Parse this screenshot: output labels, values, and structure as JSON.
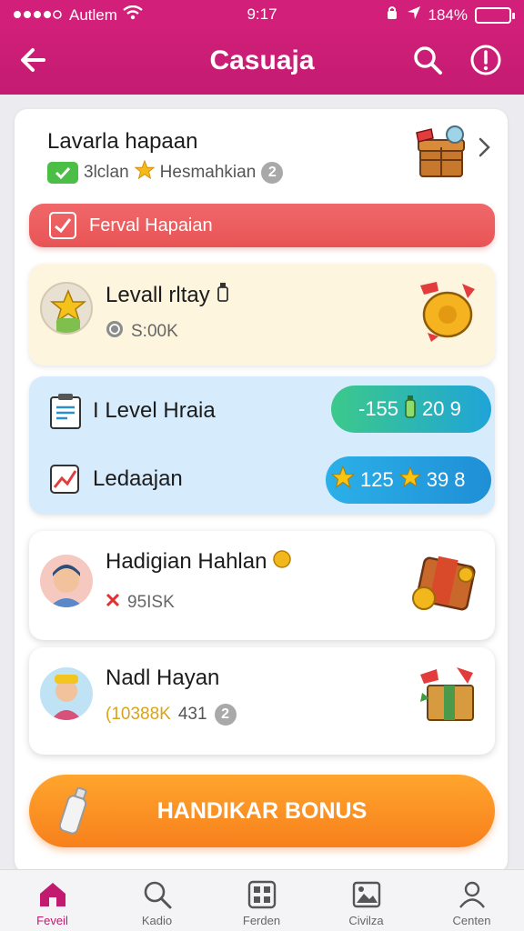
{
  "status_bar": {
    "carrier": "Autlem",
    "time": "9:17",
    "battery": "184%"
  },
  "app_bar": {
    "title": "Casuaja"
  },
  "header": {
    "title": "Lavarla hapaan",
    "sub_label": "3lclan",
    "sub_name": "Hesmahkian",
    "sub_count": "2"
  },
  "alert_bar": {
    "label": "Ferval Hapaian"
  },
  "cards": {
    "level_card": {
      "title": "Levall rltay",
      "value": "S:00K"
    },
    "level_list": [
      {
        "label": "I Level Hraia",
        "pill_left": "-155",
        "pill_right": "20 9"
      },
      {
        "label": "Ledaajan",
        "pill_left": "125",
        "pill_right": "39 8"
      }
    ],
    "player_1": {
      "title": "Hadigian Hahlan",
      "value": "95ISK"
    },
    "player_2": {
      "title": "Nadl Hayan",
      "value": "(10388K",
      "extra": "431",
      "count": "2"
    }
  },
  "bonus_button": {
    "label": "HANDIKAR BONUS"
  },
  "tabs": [
    {
      "label": "Feveil",
      "icon": "home-icon",
      "active": true
    },
    {
      "label": "Kadio",
      "icon": "search-icon",
      "active": false
    },
    {
      "label": "Ferden",
      "icon": "grid-icon",
      "active": false
    },
    {
      "label": "Civilza",
      "icon": "picture-icon",
      "active": false
    },
    {
      "label": "Centen",
      "icon": "user-icon",
      "active": false
    }
  ],
  "colors": {
    "brand": "#d21f79",
    "alert": "#eb5a5c",
    "bonus": "#f98f22",
    "pill_green": "#3cc98a",
    "pill_blue": "#1fa4d8"
  }
}
